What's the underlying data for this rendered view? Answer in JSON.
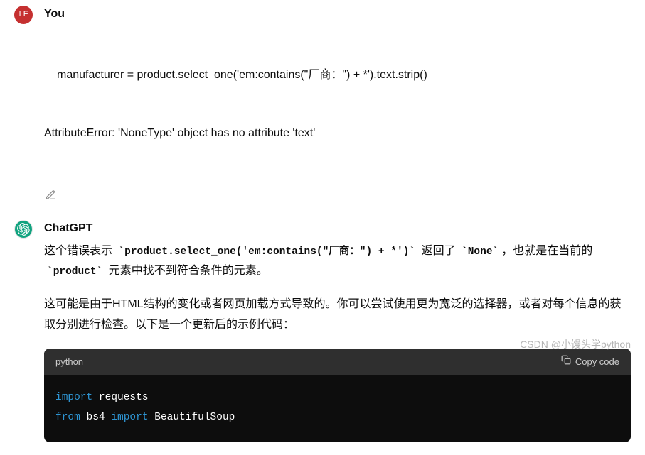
{
  "user": {
    "avatar_text": "LF",
    "name": "You",
    "line1": "manufacturer = product.select_one('em:contains(\"厂商：\") + *').text.strip()",
    "line2": "AttributeError: 'NoneType' object has no attribute 'text'"
  },
  "bot": {
    "name": "ChatGPT",
    "p1_a": "这个错误表示 ",
    "p1_code1": "`product.select_one('em:contains(\"厂商：\") + *')`",
    "p1_b": " 返回了 ",
    "p1_code2": "`None`",
    "p1_c": "，也就是在当前的 ",
    "p1_code3": "`product`",
    "p1_d": " 元素中找不到符合条件的元素。",
    "p2": "这可能是由于HTML结构的变化或者网页加载方式导致的。你可以尝试使用更为宽泛的选择器，或者对每个信息的获取分别进行检查。以下是一个更新后的示例代码："
  },
  "code": {
    "lang": "python",
    "copy_label": "Copy code",
    "l1_kw": "import",
    "l1_lib": " requests",
    "l2_kw1": "from",
    "l2_lib1": " bs4 ",
    "l2_kw2": "import",
    "l2_lib2": " BeautifulSoup"
  },
  "watermark": "CSDN @小馒头学python"
}
